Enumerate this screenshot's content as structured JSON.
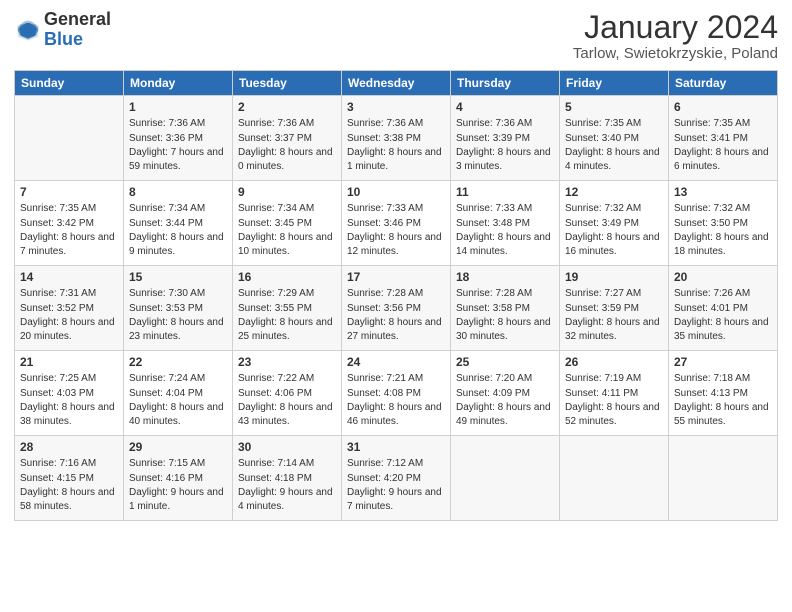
{
  "logo": {
    "line1": "General",
    "line2": "Blue"
  },
  "title": "January 2024",
  "location": "Tarlow, Swietokrzyskie, Poland",
  "days_of_week": [
    "Sunday",
    "Monday",
    "Tuesday",
    "Wednesday",
    "Thursday",
    "Friday",
    "Saturday"
  ],
  "weeks": [
    [
      {
        "day": "",
        "sunrise": "",
        "sunset": "",
        "daylight": ""
      },
      {
        "day": "1",
        "sunrise": "Sunrise: 7:36 AM",
        "sunset": "Sunset: 3:36 PM",
        "daylight": "Daylight: 7 hours and 59 minutes."
      },
      {
        "day": "2",
        "sunrise": "Sunrise: 7:36 AM",
        "sunset": "Sunset: 3:37 PM",
        "daylight": "Daylight: 8 hours and 0 minutes."
      },
      {
        "day": "3",
        "sunrise": "Sunrise: 7:36 AM",
        "sunset": "Sunset: 3:38 PM",
        "daylight": "Daylight: 8 hours and 1 minute."
      },
      {
        "day": "4",
        "sunrise": "Sunrise: 7:36 AM",
        "sunset": "Sunset: 3:39 PM",
        "daylight": "Daylight: 8 hours and 3 minutes."
      },
      {
        "day": "5",
        "sunrise": "Sunrise: 7:35 AM",
        "sunset": "Sunset: 3:40 PM",
        "daylight": "Daylight: 8 hours and 4 minutes."
      },
      {
        "day": "6",
        "sunrise": "Sunrise: 7:35 AM",
        "sunset": "Sunset: 3:41 PM",
        "daylight": "Daylight: 8 hours and 6 minutes."
      }
    ],
    [
      {
        "day": "7",
        "sunrise": "Sunrise: 7:35 AM",
        "sunset": "Sunset: 3:42 PM",
        "daylight": "Daylight: 8 hours and 7 minutes."
      },
      {
        "day": "8",
        "sunrise": "Sunrise: 7:34 AM",
        "sunset": "Sunset: 3:44 PM",
        "daylight": "Daylight: 8 hours and 9 minutes."
      },
      {
        "day": "9",
        "sunrise": "Sunrise: 7:34 AM",
        "sunset": "Sunset: 3:45 PM",
        "daylight": "Daylight: 8 hours and 10 minutes."
      },
      {
        "day": "10",
        "sunrise": "Sunrise: 7:33 AM",
        "sunset": "Sunset: 3:46 PM",
        "daylight": "Daylight: 8 hours and 12 minutes."
      },
      {
        "day": "11",
        "sunrise": "Sunrise: 7:33 AM",
        "sunset": "Sunset: 3:48 PM",
        "daylight": "Daylight: 8 hours and 14 minutes."
      },
      {
        "day": "12",
        "sunrise": "Sunrise: 7:32 AM",
        "sunset": "Sunset: 3:49 PM",
        "daylight": "Daylight: 8 hours and 16 minutes."
      },
      {
        "day": "13",
        "sunrise": "Sunrise: 7:32 AM",
        "sunset": "Sunset: 3:50 PM",
        "daylight": "Daylight: 8 hours and 18 minutes."
      }
    ],
    [
      {
        "day": "14",
        "sunrise": "Sunrise: 7:31 AM",
        "sunset": "Sunset: 3:52 PM",
        "daylight": "Daylight: 8 hours and 20 minutes."
      },
      {
        "day": "15",
        "sunrise": "Sunrise: 7:30 AM",
        "sunset": "Sunset: 3:53 PM",
        "daylight": "Daylight: 8 hours and 23 minutes."
      },
      {
        "day": "16",
        "sunrise": "Sunrise: 7:29 AM",
        "sunset": "Sunset: 3:55 PM",
        "daylight": "Daylight: 8 hours and 25 minutes."
      },
      {
        "day": "17",
        "sunrise": "Sunrise: 7:28 AM",
        "sunset": "Sunset: 3:56 PM",
        "daylight": "Daylight: 8 hours and 27 minutes."
      },
      {
        "day": "18",
        "sunrise": "Sunrise: 7:28 AM",
        "sunset": "Sunset: 3:58 PM",
        "daylight": "Daylight: 8 hours and 30 minutes."
      },
      {
        "day": "19",
        "sunrise": "Sunrise: 7:27 AM",
        "sunset": "Sunset: 3:59 PM",
        "daylight": "Daylight: 8 hours and 32 minutes."
      },
      {
        "day": "20",
        "sunrise": "Sunrise: 7:26 AM",
        "sunset": "Sunset: 4:01 PM",
        "daylight": "Daylight: 8 hours and 35 minutes."
      }
    ],
    [
      {
        "day": "21",
        "sunrise": "Sunrise: 7:25 AM",
        "sunset": "Sunset: 4:03 PM",
        "daylight": "Daylight: 8 hours and 38 minutes."
      },
      {
        "day": "22",
        "sunrise": "Sunrise: 7:24 AM",
        "sunset": "Sunset: 4:04 PM",
        "daylight": "Daylight: 8 hours and 40 minutes."
      },
      {
        "day": "23",
        "sunrise": "Sunrise: 7:22 AM",
        "sunset": "Sunset: 4:06 PM",
        "daylight": "Daylight: 8 hours and 43 minutes."
      },
      {
        "day": "24",
        "sunrise": "Sunrise: 7:21 AM",
        "sunset": "Sunset: 4:08 PM",
        "daylight": "Daylight: 8 hours and 46 minutes."
      },
      {
        "day": "25",
        "sunrise": "Sunrise: 7:20 AM",
        "sunset": "Sunset: 4:09 PM",
        "daylight": "Daylight: 8 hours and 49 minutes."
      },
      {
        "day": "26",
        "sunrise": "Sunrise: 7:19 AM",
        "sunset": "Sunset: 4:11 PM",
        "daylight": "Daylight: 8 hours and 52 minutes."
      },
      {
        "day": "27",
        "sunrise": "Sunrise: 7:18 AM",
        "sunset": "Sunset: 4:13 PM",
        "daylight": "Daylight: 8 hours and 55 minutes."
      }
    ],
    [
      {
        "day": "28",
        "sunrise": "Sunrise: 7:16 AM",
        "sunset": "Sunset: 4:15 PM",
        "daylight": "Daylight: 8 hours and 58 minutes."
      },
      {
        "day": "29",
        "sunrise": "Sunrise: 7:15 AM",
        "sunset": "Sunset: 4:16 PM",
        "daylight": "Daylight: 9 hours and 1 minute."
      },
      {
        "day": "30",
        "sunrise": "Sunrise: 7:14 AM",
        "sunset": "Sunset: 4:18 PM",
        "daylight": "Daylight: 9 hours and 4 minutes."
      },
      {
        "day": "31",
        "sunrise": "Sunrise: 7:12 AM",
        "sunset": "Sunset: 4:20 PM",
        "daylight": "Daylight: 9 hours and 7 minutes."
      },
      {
        "day": "",
        "sunrise": "",
        "sunset": "",
        "daylight": ""
      },
      {
        "day": "",
        "sunrise": "",
        "sunset": "",
        "daylight": ""
      },
      {
        "day": "",
        "sunrise": "",
        "sunset": "",
        "daylight": ""
      }
    ]
  ]
}
